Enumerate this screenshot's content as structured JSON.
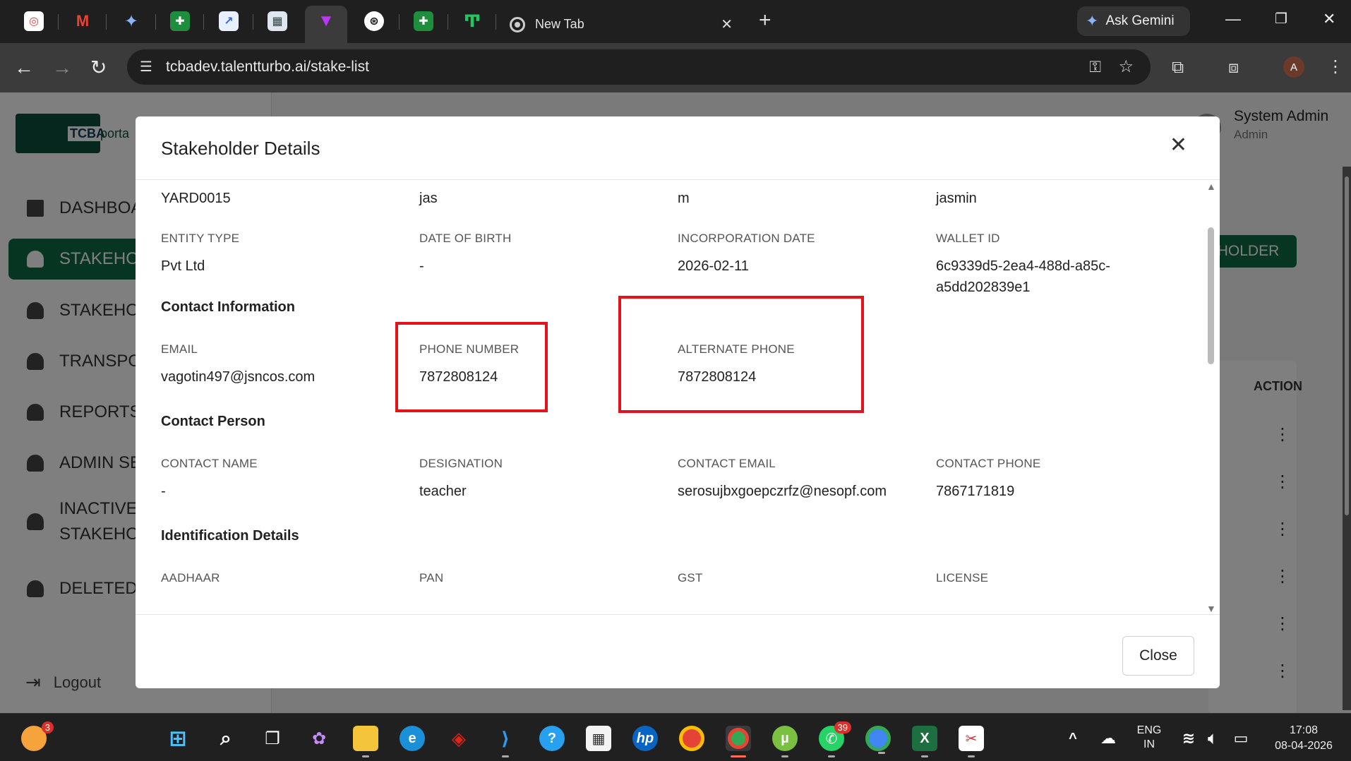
{
  "browser": {
    "tab_new_label": "New Tab",
    "gemini_label": "Ask Gemini",
    "url": "tcbadev.talentturbo.ai/stake-list",
    "profile_initial": "A"
  },
  "app": {
    "logo_text": "TCBA",
    "logo_text2": "porta",
    "nav": [
      {
        "label": "DASHBOA"
      },
      {
        "label": "STAKEHOL"
      },
      {
        "label": "STAKEHOL"
      },
      {
        "label": "TRANSPO"
      },
      {
        "label": "REPORTS"
      },
      {
        "label": "ADMIN SE"
      },
      {
        "label": "INACTIVE"
      },
      {
        "label": "STAKEHOL"
      },
      {
        "label": "DELETED S"
      }
    ],
    "logout_label": "Logout",
    "user_name": "System Admin",
    "user_role": "Admin",
    "holder_button": "HOLDER",
    "action_header": "ACTION"
  },
  "modal": {
    "title": "Stakeholder Details",
    "row0": [
      "YARD0015",
      "jas",
      "m",
      "jasmin"
    ],
    "basic": {
      "entity_type_label": "ENTITY TYPE",
      "entity_type": "Pvt Ltd",
      "dob_label": "DATE OF BIRTH",
      "dob": "-",
      "inc_label": "INCORPORATION DATE",
      "inc": "2026-02-11",
      "wallet_label": "WALLET ID",
      "wallet_line1": "6c9339d5-2ea4-488d-a85c-",
      "wallet_line2": "a5dd202839e1"
    },
    "contact_info": {
      "heading": "Contact Information",
      "email_label": "EMAIL",
      "email": "vagotin497@jsncos.com",
      "phone_label": "PHONE NUMBER",
      "phone": "7872808124",
      "alt_label": "ALTERNATE PHONE",
      "alt": "7872808124"
    },
    "contact_person": {
      "heading": "Contact Person",
      "name_label": "CONTACT NAME",
      "name": "-",
      "designation_label": "DESIGNATION",
      "designation": "teacher",
      "email_label": "CONTACT EMAIL",
      "email": "serosujbxgoepczrfz@nesopf.com",
      "phone_label": "CONTACT PHONE",
      "phone": "7867171819"
    },
    "identification": {
      "heading": "Identification Details",
      "aadhaar_label": "AADHAAR",
      "pan_label": "PAN",
      "gst_label": "GST",
      "license_label": "LICENSE"
    },
    "close_label": "Close"
  },
  "taskbar": {
    "weather_badge": "3",
    "whatsapp_badge": "39",
    "lang_line1": "ENG",
    "lang_line2": "IN",
    "time": "17:08",
    "date": "08-04-2026"
  },
  "colors": {
    "brand_green": "#0d6b45",
    "highlight_red": "#e3121b"
  }
}
